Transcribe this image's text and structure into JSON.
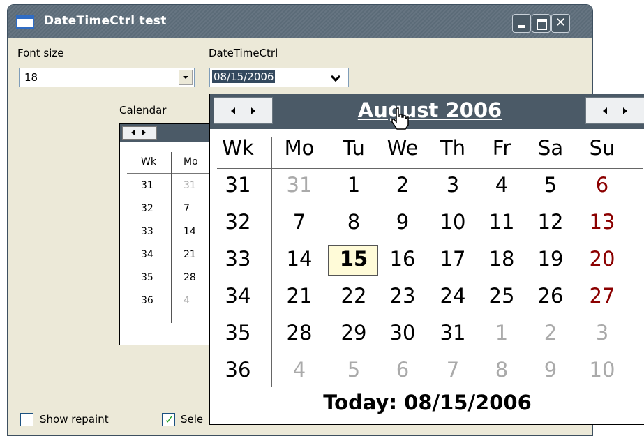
{
  "window": {
    "title": "DateTimeCtrl test"
  },
  "labels": {
    "font_size": "Font size",
    "datetimectrl": "DateTimeCtrl",
    "calendar": "Calendar"
  },
  "font_size_combo": {
    "value": "18"
  },
  "datetime_ctrl": {
    "value": "08/15/2006"
  },
  "small_calendar": {
    "headers": [
      "Wk",
      "Mo"
    ],
    "rows": [
      {
        "wk": "31",
        "mo": "31",
        "mo_gray": true
      },
      {
        "wk": "32",
        "mo": "7"
      },
      {
        "wk": "33",
        "mo": "14"
      },
      {
        "wk": "34",
        "mo": "21"
      },
      {
        "wk": "35",
        "mo": "28"
      },
      {
        "wk": "36",
        "mo": "4",
        "mo_gray": true
      }
    ]
  },
  "checkboxes": {
    "show_repaint": {
      "label": "Show repaint",
      "checked": false
    },
    "select": {
      "label": "Sele",
      "checked": true
    }
  },
  "popup_calendar": {
    "month_label": "August 2006",
    "headers": [
      "Wk",
      "Mo",
      "Tu",
      "We",
      "Th",
      "Fr",
      "Sa",
      "Su"
    ],
    "rows": [
      {
        "wk": "31",
        "days": [
          "31",
          "1",
          "2",
          "3",
          "4",
          "5",
          "6"
        ]
      },
      {
        "wk": "32",
        "days": [
          "7",
          "8",
          "9",
          "10",
          "11",
          "12",
          "13"
        ]
      },
      {
        "wk": "33",
        "days": [
          "14",
          "15",
          "16",
          "17",
          "18",
          "19",
          "20"
        ]
      },
      {
        "wk": "34",
        "days": [
          "21",
          "22",
          "23",
          "24",
          "25",
          "26",
          "27"
        ]
      },
      {
        "wk": "35",
        "days": [
          "28",
          "29",
          "30",
          "31",
          "1",
          "2",
          "3"
        ]
      },
      {
        "wk": "36",
        "days": [
          "4",
          "5",
          "6",
          "7",
          "8",
          "9",
          "10"
        ]
      }
    ],
    "selected_day": "15",
    "today_text": "Today: 08/15/2006"
  },
  "colors": {
    "header_bg": "#4b5a67",
    "sunday_red": "#8b0000",
    "other_month_gray": "#aaaaaa",
    "selected_bg": "#fffbd8"
  }
}
